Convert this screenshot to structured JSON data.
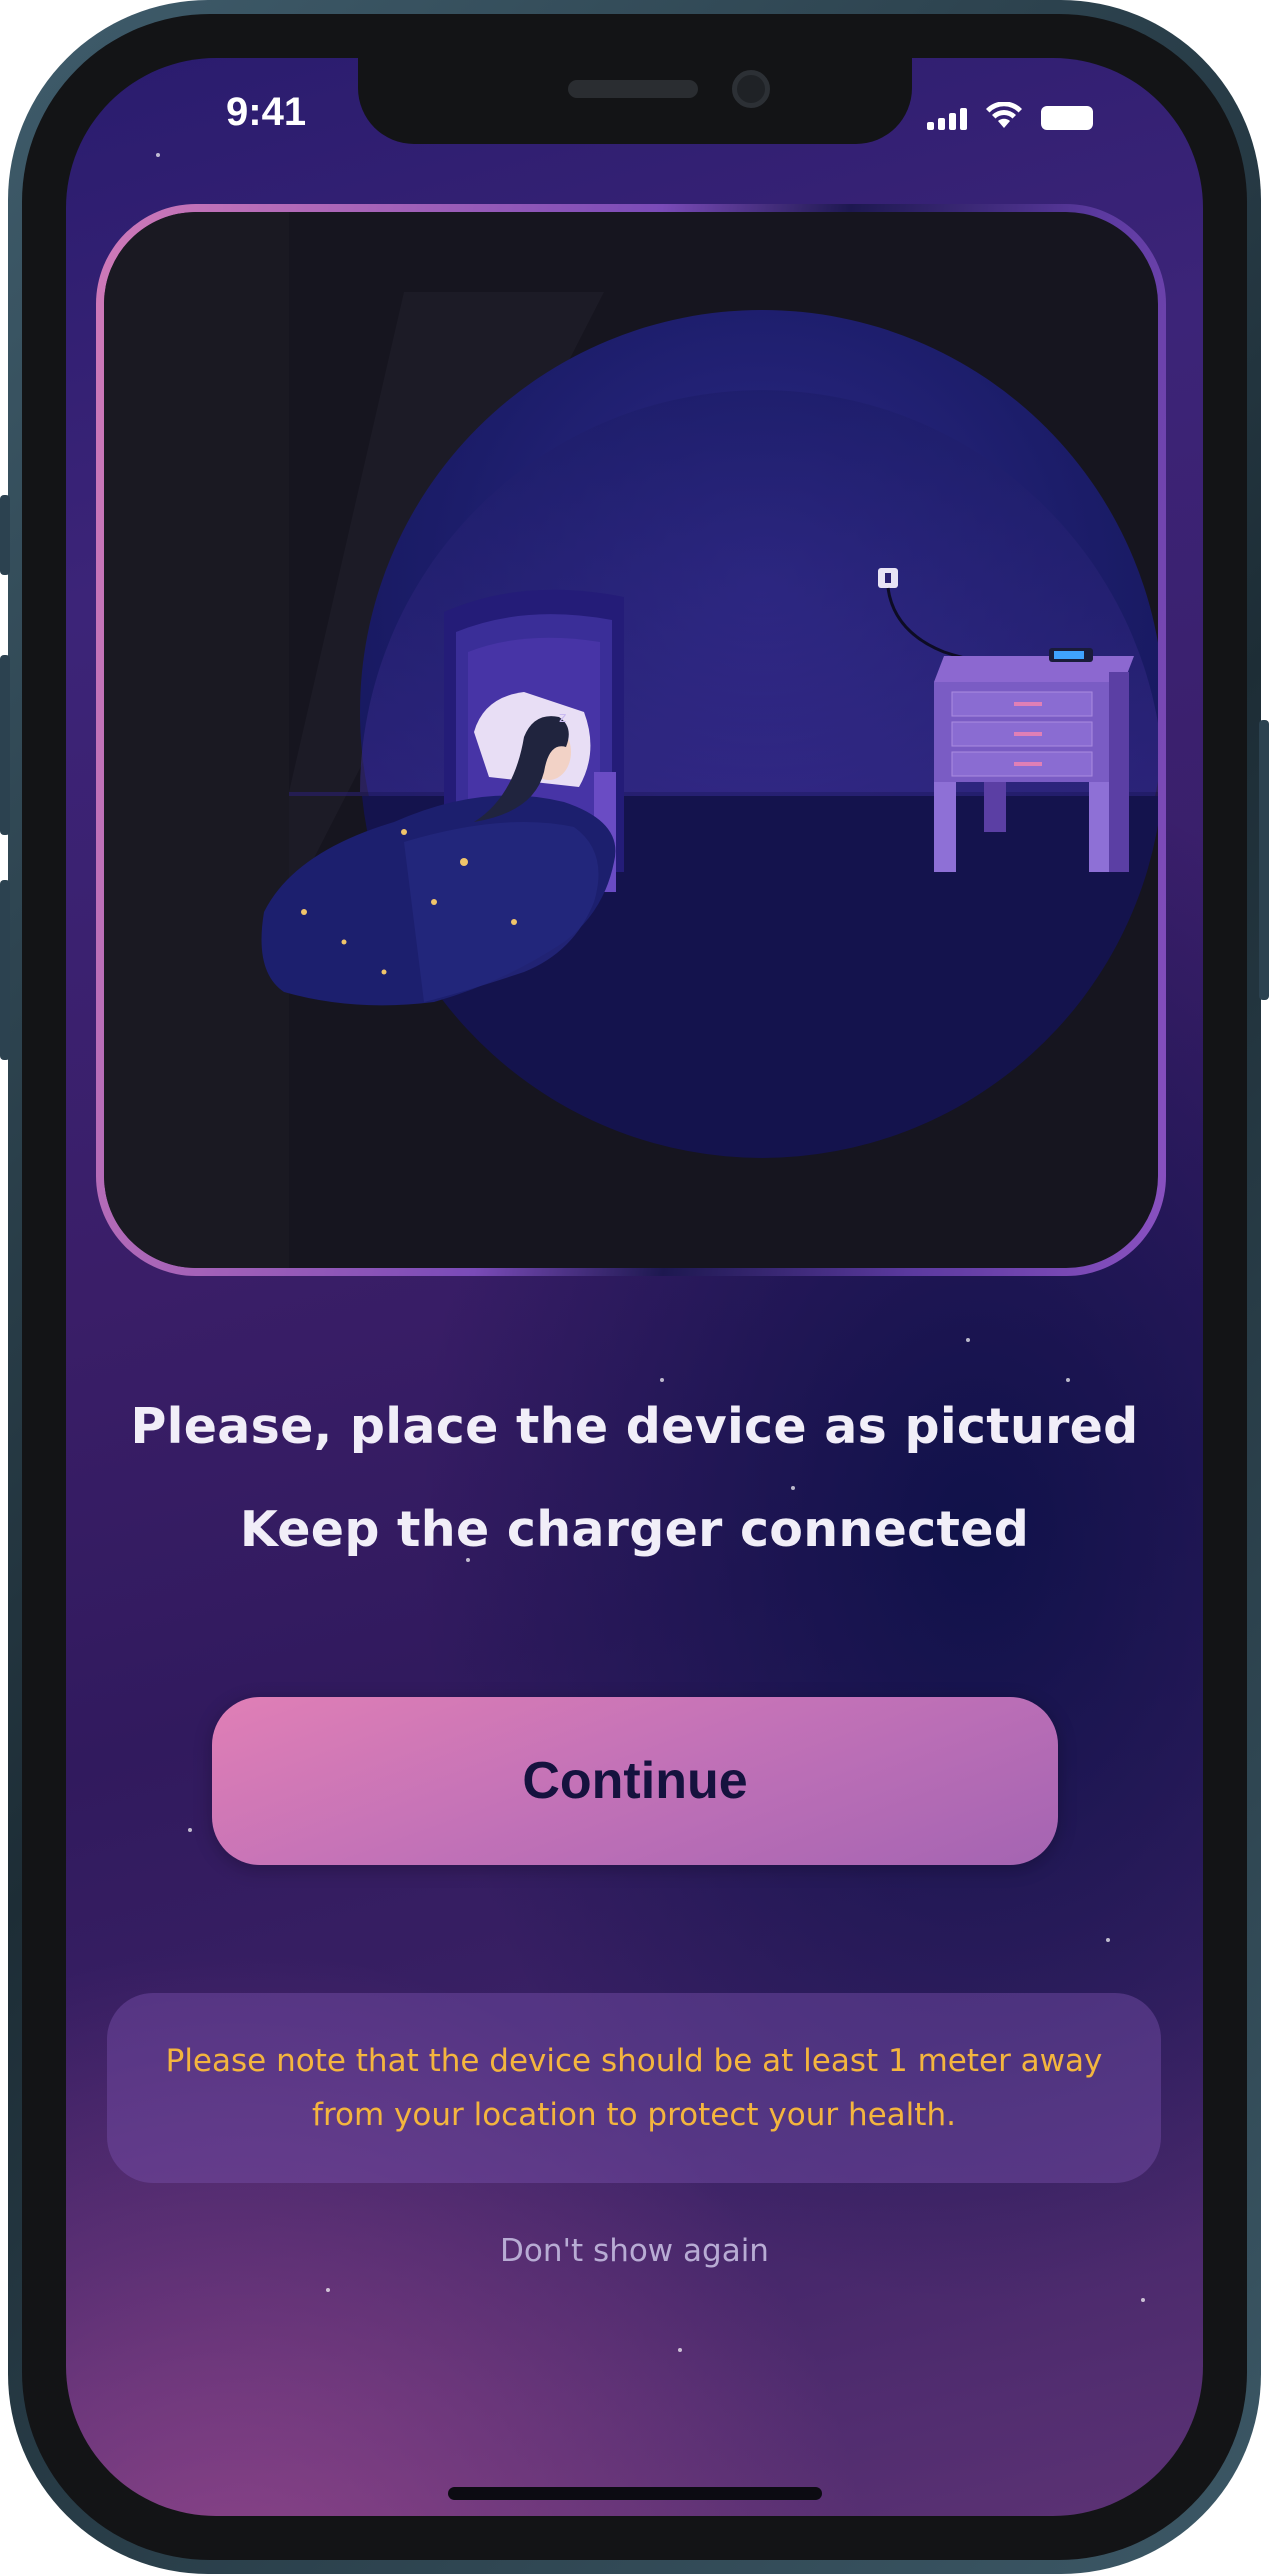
{
  "status_bar": {
    "time": "9:41",
    "icons": [
      "signal-icon",
      "wifi-icon",
      "battery-icon"
    ]
  },
  "illustration": {
    "scene": "sleeping-person-with-phone-charging-on-nightstand"
  },
  "instructions": {
    "line1": "Please, place the device as pictured",
    "line2": "Keep the charger connected"
  },
  "continue_button": {
    "label": "Continue"
  },
  "note": {
    "line1": "Please note that the device should be at least 1 meter away",
    "line2": "from your location to protect your health."
  },
  "dont_show_again": {
    "label": "Don't show again"
  },
  "colors": {
    "accent_pink": "#d47ab6",
    "note_text": "#f4b53e",
    "button_text": "#15123e"
  }
}
